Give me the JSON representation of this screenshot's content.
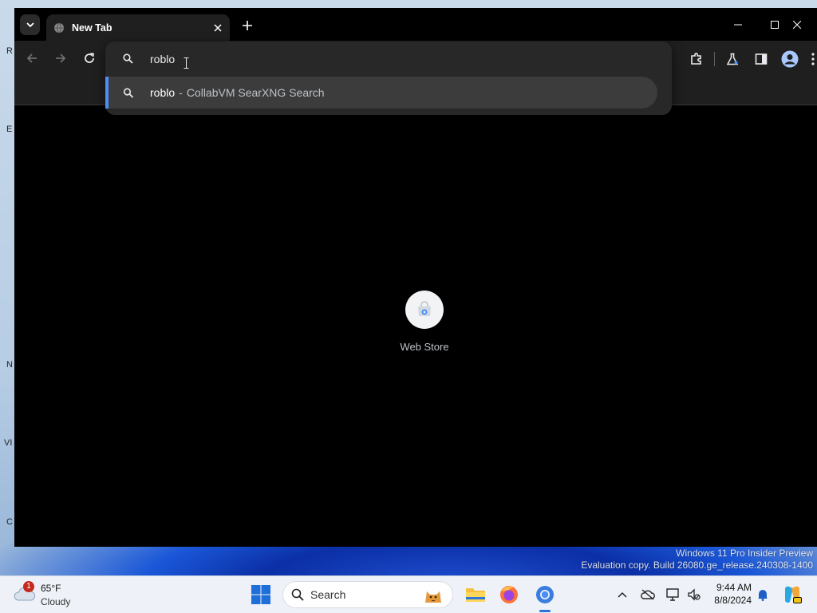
{
  "browser": {
    "tab": {
      "title": "New Tab"
    },
    "omnibox": {
      "value": "roblo",
      "suggestion": {
        "query": "roblo",
        "separator": "-",
        "provider": "CollabVM SearXNG Search"
      }
    },
    "new_tab_page": {
      "shortcuts": [
        {
          "label": "Web Store"
        }
      ]
    },
    "accent_color": "#4c8df6"
  },
  "desktop": {
    "watermark_line1": "Windows 11 Pro Insider Preview",
    "watermark_line2": "Evaluation copy. Build 26080.ge_release.240308-1400",
    "icon_fragments": [
      "R",
      "E",
      "N",
      "VI",
      "C"
    ]
  },
  "taskbar": {
    "weather": {
      "temp": "65°F",
      "condition": "Cloudy",
      "badge": "1"
    },
    "search_label": "Search",
    "clock": {
      "time": "9:44 AM",
      "date": "8/8/2024"
    }
  }
}
